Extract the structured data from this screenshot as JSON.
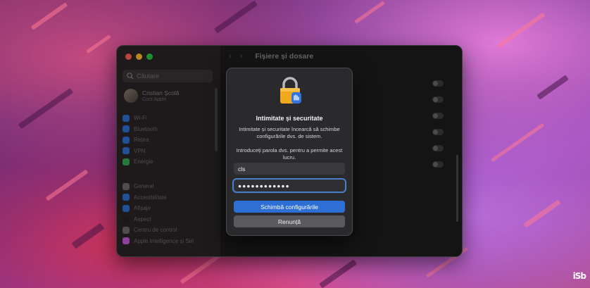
{
  "window": {
    "title": "Fișiere și dosare",
    "sidebar": {
      "search_placeholder": "Căutare",
      "account": {
        "name": "Cristian Școlă",
        "subtitle": "Cont Apple"
      },
      "group1": [
        {
          "label": "Wi-Fi",
          "color": "#2f6fd1"
        },
        {
          "label": "Bluetooth",
          "color": "#2f6fd1"
        },
        {
          "label": "Rețea",
          "color": "#2f6fd1"
        },
        {
          "label": "VPN",
          "color": "#2f6fd1"
        },
        {
          "label": "Energie",
          "color": "#35a853"
        }
      ],
      "group2": [
        {
          "label": "General",
          "color": "#6b6b70"
        },
        {
          "label": "Accesibilitate",
          "color": "#2f6fd1"
        },
        {
          "label": "Afișaje",
          "color": "#2f6fd1"
        },
        {
          "label": "Aspect",
          "color": "#222222"
        },
        {
          "label": "Centru de control",
          "color": "#6b6b70"
        },
        {
          "label": "Apple Intelligence și Siri",
          "color": "#c05ad8"
        }
      ]
    },
    "toggles_count": 6
  },
  "dialog": {
    "icon": "lock-icon",
    "title": "Intimitate și securitate",
    "message": "Intimitate și securitate încearcă să schimbe configurările dvs. de sistem.",
    "prompt": "Introduceți parola dvs. pentru a permite acest lucru.",
    "username_value": "cls",
    "password_value": "●●●●●●●●●●●●",
    "primary_button": "Schimbă configurările",
    "secondary_button": "Renunță"
  },
  "watermark": "iSb"
}
